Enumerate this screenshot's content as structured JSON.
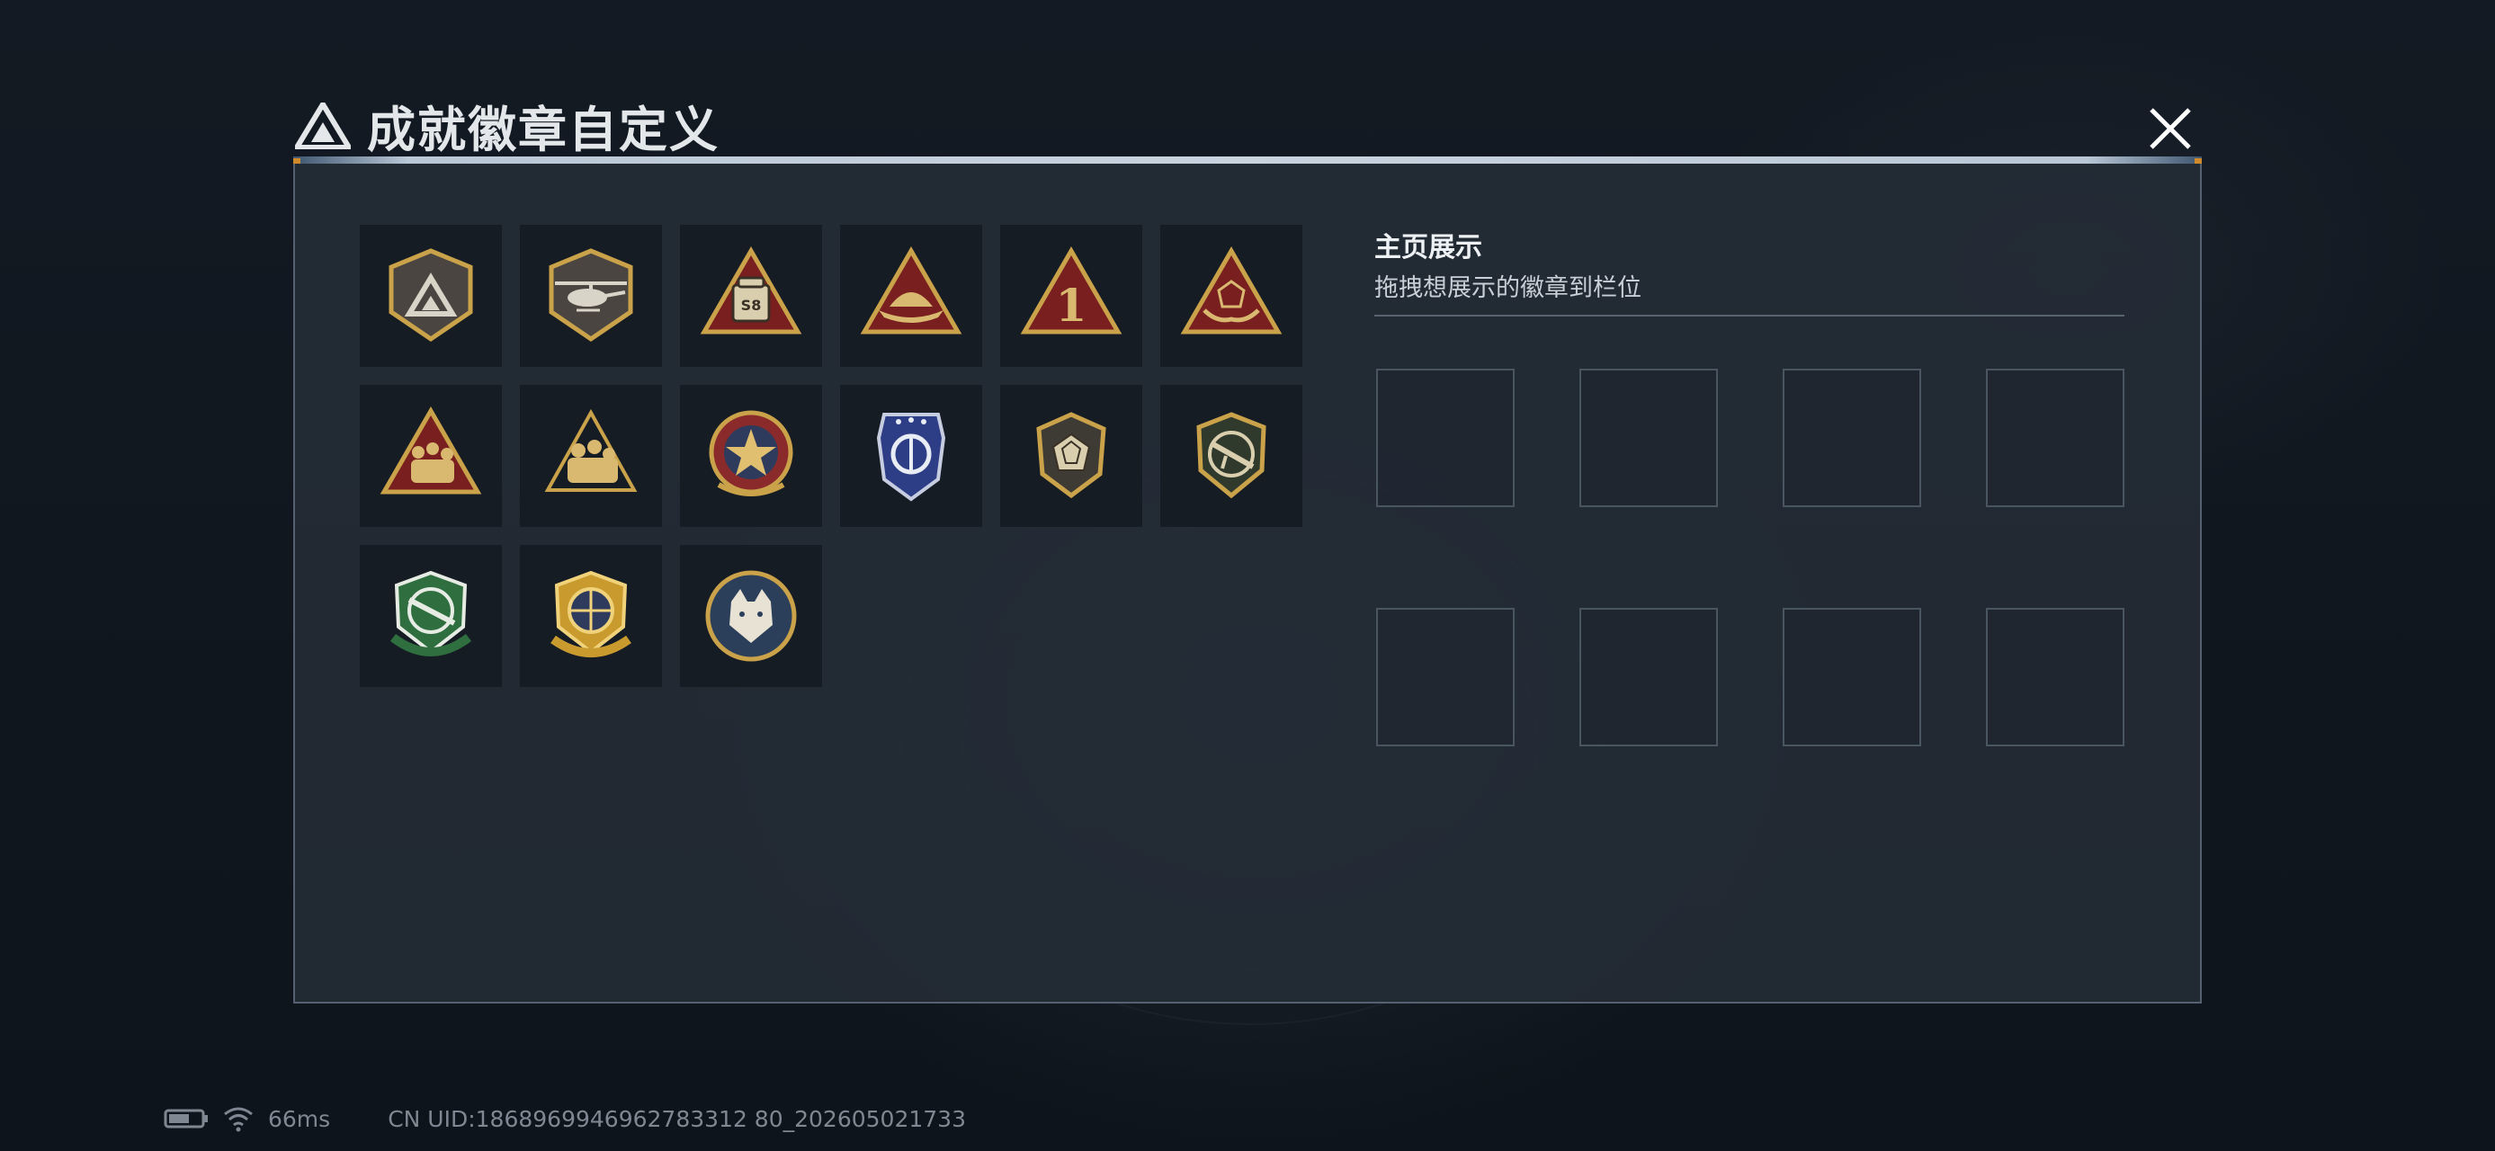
{
  "title": "成就徽章自定义",
  "title_tiny": "",
  "display": {
    "title": "主页展示",
    "subtitle": "拖拽想展示的徽章到栏位",
    "slot_count": 8
  },
  "badges": [
    {
      "name": "badge-triangle-shield",
      "label": ""
    },
    {
      "name": "badge-helicopter",
      "label": ""
    },
    {
      "name": "badge-s8-bag",
      "label": "S8"
    },
    {
      "name": "badge-hat",
      "label": ""
    },
    {
      "name": "badge-number-one",
      "label": "1"
    },
    {
      "name": "badge-hands-gem",
      "label": ""
    },
    {
      "name": "badge-soldiers",
      "label": ""
    },
    {
      "name": "badge-soldiers-gold",
      "label": ""
    },
    {
      "name": "badge-star-seal",
      "label": ""
    },
    {
      "name": "badge-blue-shield",
      "label": ""
    },
    {
      "name": "badge-gem-shield",
      "label": ""
    },
    {
      "name": "badge-rifle-shield",
      "label": ""
    },
    {
      "name": "badge-green-rifle",
      "label": ""
    },
    {
      "name": "badge-gold-crosshair",
      "label": ""
    },
    {
      "name": "badge-wolf",
      "label": ""
    }
  ],
  "status": {
    "ping": "66ms",
    "uid": "CN UID:1868969946962783312 80_202605021733"
  },
  "colors": {
    "background": "#0f151d",
    "panel": "#242c37",
    "gold": "#c9a24a",
    "red": "#7a1f1f",
    "slot_border": "#4a5562"
  }
}
